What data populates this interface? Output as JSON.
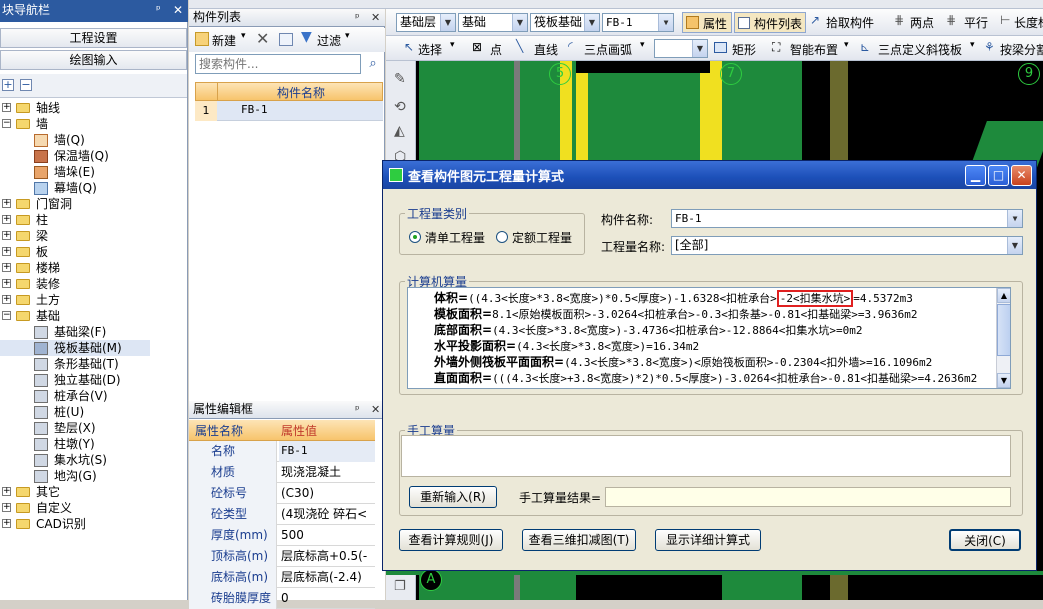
{
  "left_nav": {
    "title": "块导航栏",
    "btn_project": "工程设置",
    "btn_drawing": "绘图输入",
    "tree": {
      "axis": "轴线",
      "wall": "墙",
      "wall_children": [
        "墙(Q)",
        "保温墙(Q)",
        "墙垛(E)",
        "幕墙(Q)"
      ],
      "door_window": "门窗洞",
      "column": "柱",
      "beam": "梁",
      "slab": "板",
      "stair": "楼梯",
      "decoration": "装修",
      "earthwork": "土方",
      "foundation": "基础",
      "foundation_children": [
        "基础梁(F)",
        "筏板基础(M)",
        "条形基础(T)",
        "独立基础(D)",
        "桩承台(V)",
        "桩(U)",
        "垫层(X)",
        "柱墩(Y)",
        "集水坑(S)",
        "地沟(G)"
      ],
      "other": "其它",
      "custom": "自定义",
      "cad": "CAD识别"
    }
  },
  "component_list": {
    "title": "构件列表",
    "new_label": "新建",
    "filter_label": "过滤",
    "search_placeholder": "搜索构件...",
    "column_header": "构件名称",
    "rows": [
      {
        "index": "1",
        "name": "FB-1"
      }
    ]
  },
  "property_grid": {
    "title": "属性编辑框",
    "header_name": "属性名称",
    "header_value": "属性值",
    "rows": [
      {
        "index": "1",
        "name": "名称",
        "value": "FB-1"
      },
      {
        "index": "2",
        "name": "材质",
        "value": "现浇混凝土"
      },
      {
        "index": "3",
        "name": "砼标号",
        "value": "(C30)"
      },
      {
        "index": "4",
        "name": "砼类型",
        "value": "(4现浇砼 碎石<"
      },
      {
        "index": "5",
        "name": "厚度(mm)",
        "value": "500"
      },
      {
        "index": "6",
        "name": "顶标高(m)",
        "value": "层底标高+0.5(-"
      },
      {
        "index": "7",
        "name": "底标高(m)",
        "value": "层底标高(-2.4)"
      },
      {
        "index": "8",
        "name": "砖胎膜厚度",
        "value": "0"
      }
    ]
  },
  "toolbar": {
    "layer": "基础层",
    "category": "基础",
    "type": "筏板基础",
    "component": "FB-1",
    "property_btn": "属性",
    "component_list_btn": "构件列表",
    "pick_btn": "拾取构件",
    "two_point_btn": "两点",
    "parallel_btn": "平行",
    "length_btn": "长度标",
    "select_btn": "选择",
    "point_btn": "点",
    "line_btn": "直线",
    "arc_btn": "三点画弧",
    "rect_btn": "矩形",
    "smart_btn": "智能布置",
    "slope_btn": "三点定义斜筏板",
    "split_btn": "按梁分割"
  },
  "canvas": {
    "axis_labels": [
      "5",
      "7",
      "9",
      "A"
    ]
  },
  "dialog": {
    "title": "查看构件图元工程量计算式",
    "quantity_type_label": "工程量类别",
    "radio_bill": "清单工程量",
    "radio_quota": "定额工程量",
    "component_name_label": "构件名称:",
    "component_name_value": "FB-1",
    "quantity_name_label": "工程量名称:",
    "quantity_name_value": "[全部]",
    "computer_calc_label": "计算机算量",
    "calc_lines": [
      {
        "label": "体积=",
        "formula": "((4.3<长度>*3.8<宽度>)*0.5<厚度>)-1.6328<扣桩承台>",
        "highlight": "-2<扣集水坑>",
        "result": "=4.5372m3"
      },
      {
        "label": "模板面积=",
        "formula": "8.1<原始模板面积>-3.0264<扣桩承台>-0.3<扣条基>-0.81<扣基础梁>=3.9636m2",
        "highlight": "",
        "result": ""
      },
      {
        "label": "底部面积=",
        "formula": "(4.3<长度>*3.8<宽度>)-3.4736<扣桩承台>-12.8864<扣集水坑>=0m2",
        "highlight": "",
        "result": ""
      },
      {
        "label": "水平投影面积=",
        "formula": "(4.3<长度>*3.8<宽度>)=16.34m2",
        "highlight": "",
        "result": ""
      },
      {
        "label": "外墙外侧筏板平面面积=",
        "formula": "(4.3<长度>*3.8<宽度>)<原始筏板面积>-0.2304<扣外墙>=16.1096m2",
        "highlight": "",
        "result": ""
      },
      {
        "label": "直面面积=",
        "formula": "(((4.3<长度>+3.8<宽度>)*2)*0.5<厚度>)-3.0264<扣桩承台>-0.81<扣基础梁>=4.2636m2",
        "highlight": "",
        "result": ""
      }
    ],
    "manual_calc_label": "手工算量",
    "reenter_btn": "重新输入(R)",
    "manual_result_label": "手工算量结果=",
    "btn_rules": "查看计算规则(J)",
    "btn_3d": "查看三维扣减图(T)",
    "btn_detail": "显示详细计算式",
    "btn_close": "关闭(C)"
  },
  "colors": {
    "accent_blue": "#2c5aa0",
    "canvas_green": "#1e8a3c",
    "highlight_red": "#e02020",
    "yellow": "#f0e020"
  }
}
